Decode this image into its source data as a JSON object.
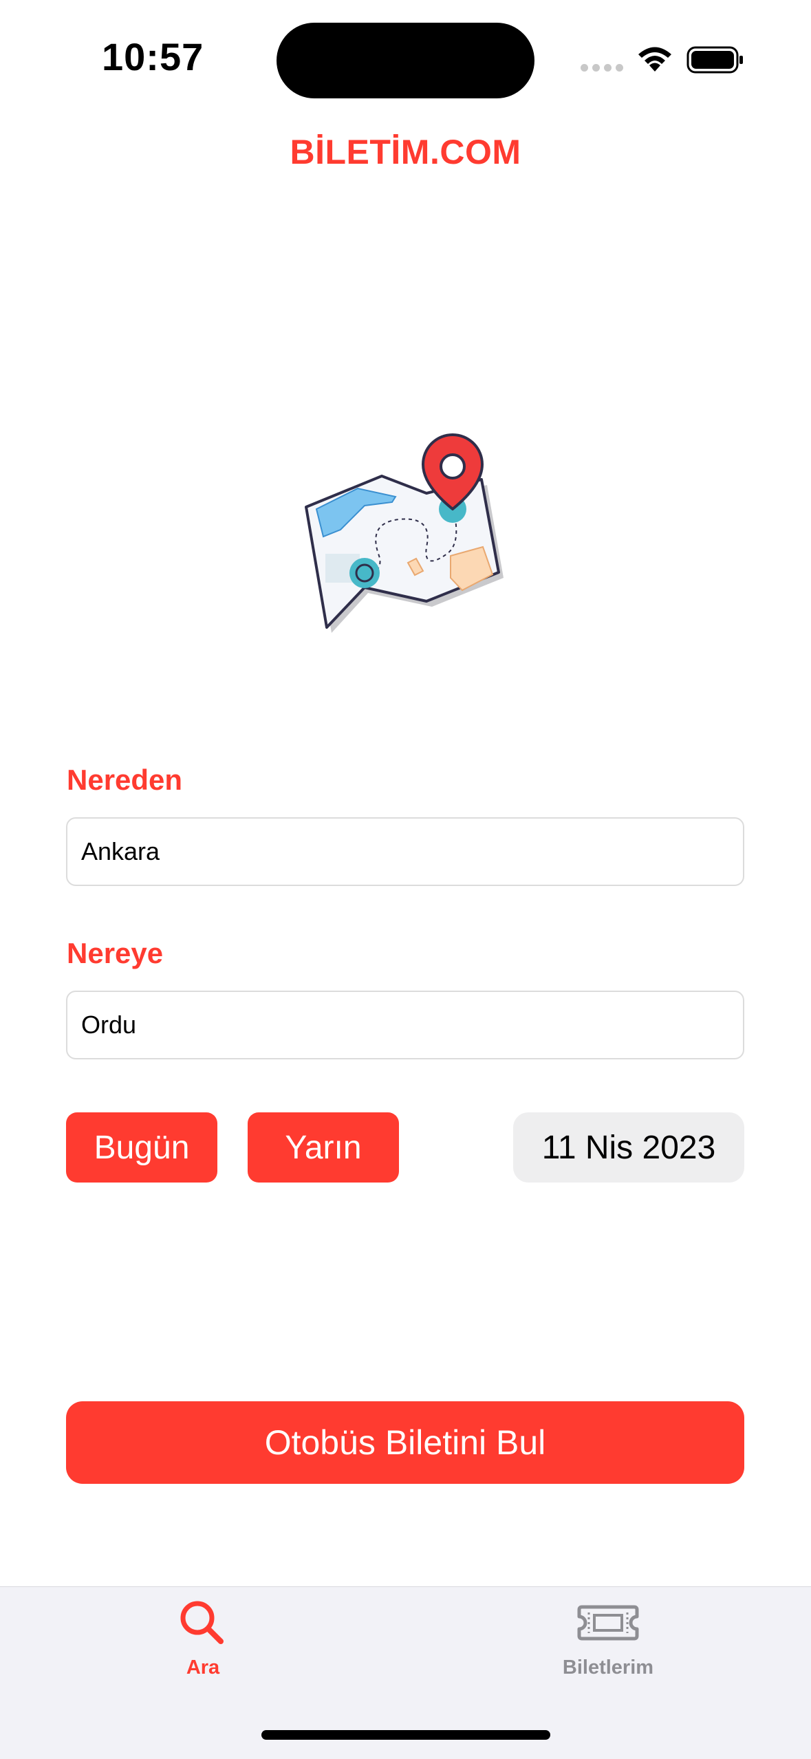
{
  "status_bar": {
    "time": "10:57"
  },
  "header": {
    "title": "BİLETİM.COM"
  },
  "illustration": {
    "icon": "map-route-icon"
  },
  "form": {
    "from": {
      "label": "Nereden",
      "value": "Ankara"
    },
    "to": {
      "label": "Nereye",
      "value": "Ordu"
    },
    "today_label": "Bugün",
    "tomorrow_label": "Yarın",
    "date_value": "11 Nis 2023",
    "search_label": "Otobüs Biletini Bul"
  },
  "tab_bar": {
    "tabs": [
      {
        "label": "Ara",
        "icon": "search-icon",
        "active": true
      },
      {
        "label": "Biletlerim",
        "icon": "ticket-icon",
        "active": false
      }
    ]
  },
  "colors": {
    "accent": "#ff3b30",
    "inactive": "#8e8e93",
    "tab_bar_bg": "#f2f2f7",
    "date_bg": "#eeeeef"
  }
}
